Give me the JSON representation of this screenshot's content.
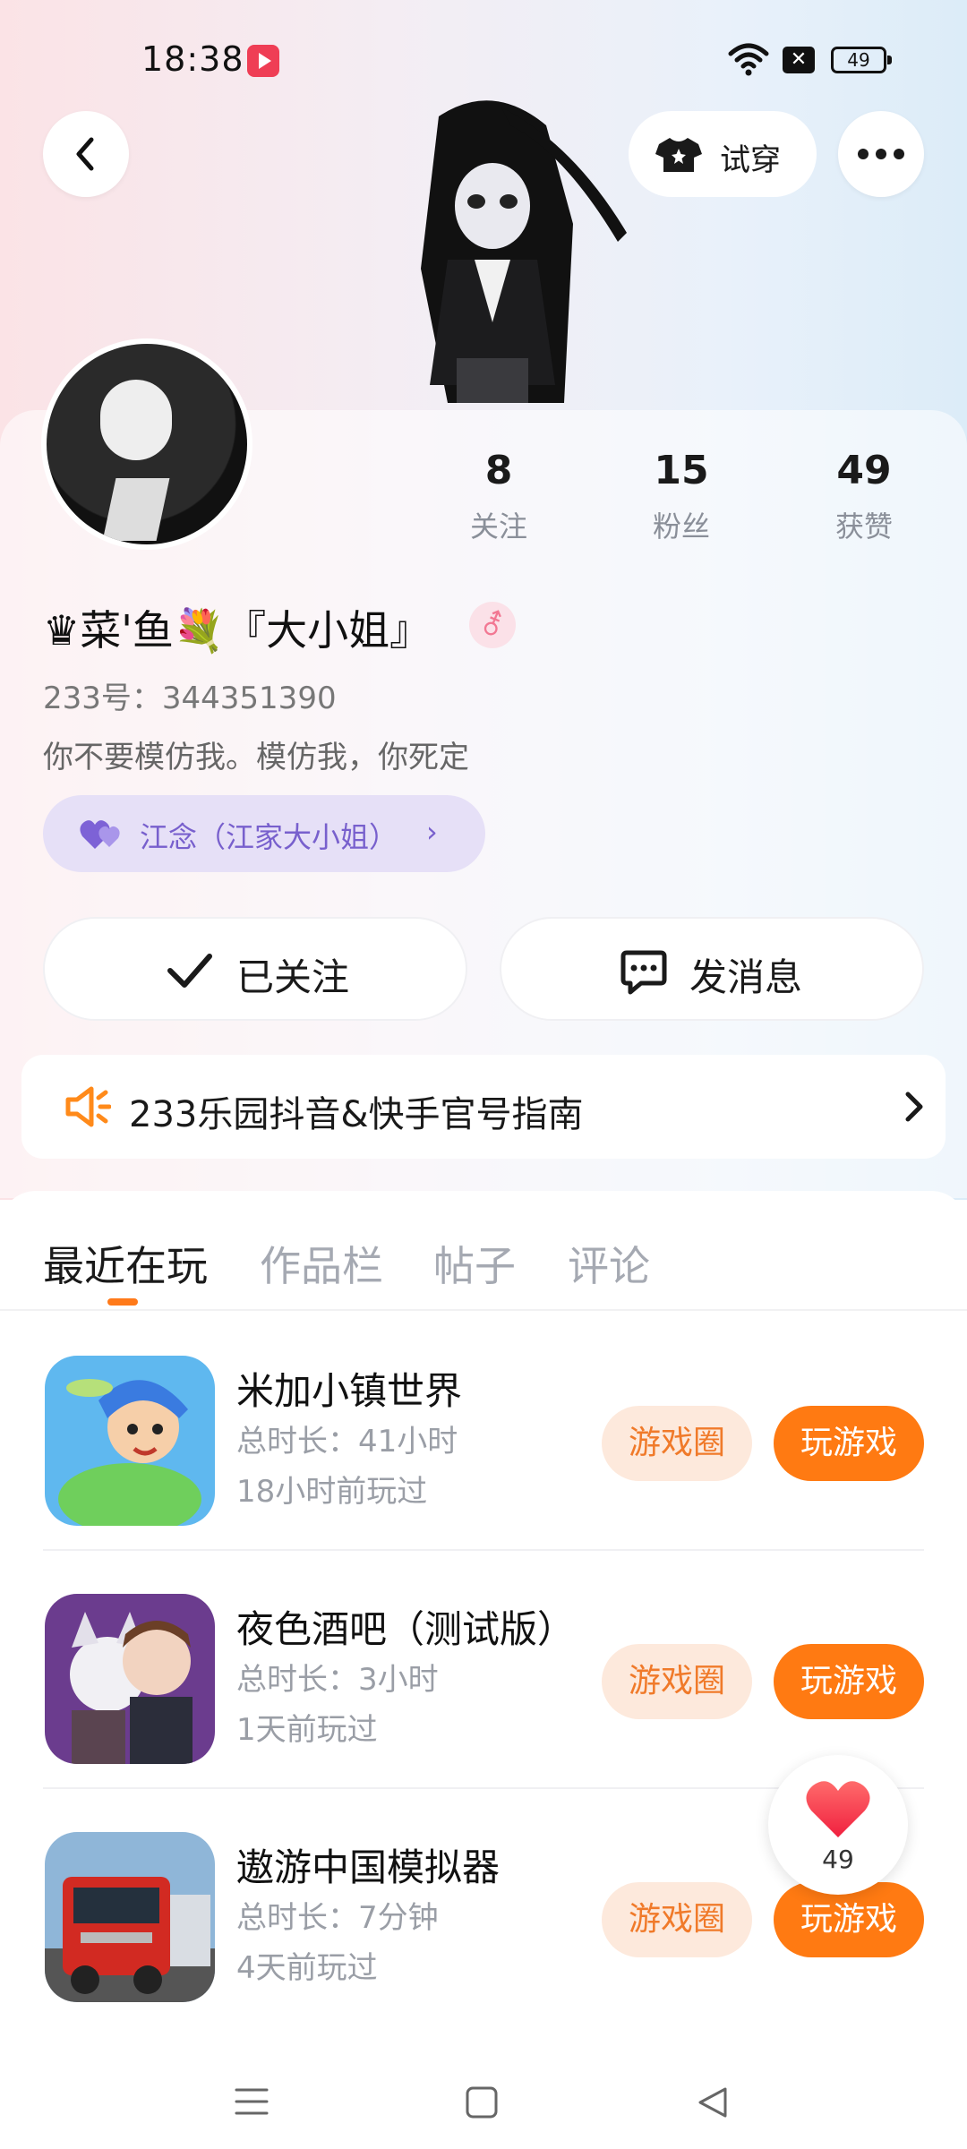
{
  "status_bar": {
    "time": "18:38",
    "battery": "49"
  },
  "header": {
    "try_on_label": "试穿"
  },
  "profile": {
    "stats": [
      {
        "value": "8",
        "label": "关注"
      },
      {
        "value": "15",
        "label": "粉丝"
      },
      {
        "value": "49",
        "label": "获赞"
      }
    ],
    "name": "♛菜'鱼💐『大小姐』",
    "gender_symbol": "⚦",
    "uid": "233号：344351390",
    "bio": "你不要模仿我。模仿我，你死定",
    "cp_label": "江念（江家大小姐）"
  },
  "actions": {
    "followed_label": "已关注",
    "message_label": "发消息"
  },
  "banner": {
    "text": "233乐园抖音&快手官号指南"
  },
  "tabs": [
    {
      "label": "最近在玩",
      "active": true
    },
    {
      "label": "作品栏",
      "active": false
    },
    {
      "label": "帖子",
      "active": false
    },
    {
      "label": "评论",
      "active": false
    }
  ],
  "games": [
    {
      "name": "米加小镇世界",
      "duration": "总时长：41小时",
      "last_played": "18小时前玩过",
      "circle_label": "游戏圈",
      "play_label": "玩游戏"
    },
    {
      "name": "夜色酒吧（测试版）",
      "duration": "总时长：3小时",
      "last_played": "1天前玩过",
      "circle_label": "游戏圈",
      "play_label": "玩游戏"
    },
    {
      "name": "遨游中国模拟器",
      "duration": "总时长：7分钟",
      "last_played": "4天前玩过",
      "circle_label": "游戏圈",
      "play_label": "玩游戏"
    }
  ],
  "like_float": {
    "count": "49"
  },
  "colors": {
    "accent_orange": "#ff7a12",
    "cp_purple": "#7860cd",
    "tab_indicator": "#ff7a1a"
  }
}
